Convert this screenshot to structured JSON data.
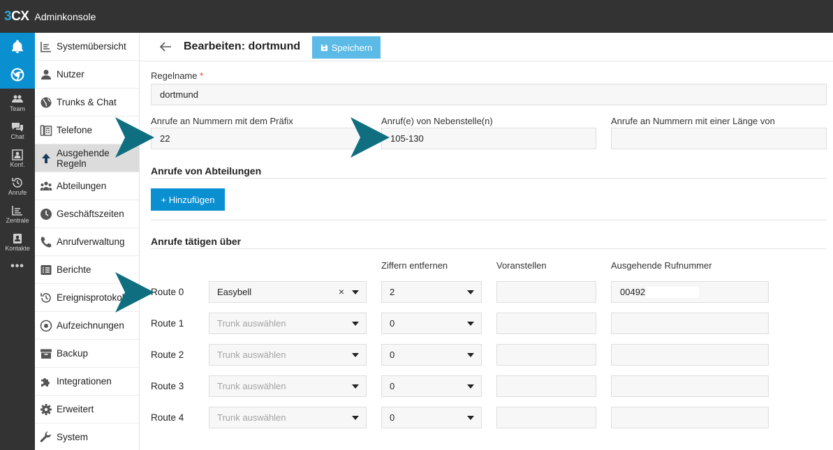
{
  "app": {
    "logo_num": "3",
    "logo_text": "CX",
    "title": "Adminkonsole"
  },
  "rail": [
    {
      "label": "Team",
      "icon": "team-icon"
    },
    {
      "label": "Chat",
      "icon": "chat-icon"
    },
    {
      "label": "Konf.",
      "icon": "conference-icon"
    },
    {
      "label": "Anrufe",
      "icon": "history-icon"
    },
    {
      "label": "Zentrale",
      "icon": "switchboard-icon"
    },
    {
      "label": "Kontakte",
      "icon": "contacts-icon"
    }
  ],
  "rail_more": "•••",
  "nav": [
    {
      "label": "Systemübersicht",
      "icon": "dashboard-icon"
    },
    {
      "label": "Nutzer",
      "icon": "user-icon"
    },
    {
      "label": "Trunks & Chat",
      "icon": "globe-icon"
    },
    {
      "label": "Telefone",
      "icon": "phone-device-icon"
    },
    {
      "label": "Ausgehende\nRegeln",
      "icon": "arrow-up-icon"
    },
    {
      "label": "Abteilungen",
      "icon": "group-icon"
    },
    {
      "label": "Geschäftszeiten",
      "icon": "clock-icon"
    },
    {
      "label": "Anrufverwaltung",
      "icon": "phone-icon"
    },
    {
      "label": "Berichte",
      "icon": "report-icon"
    },
    {
      "label": "Ereignisprotokoll",
      "icon": "history-icon"
    },
    {
      "label": "Aufzeichnungen",
      "icon": "record-icon"
    },
    {
      "label": "Backup",
      "icon": "archive-icon"
    },
    {
      "label": "Integrationen",
      "icon": "puzzle-icon"
    },
    {
      "label": "Erweitert",
      "icon": "gear-icon"
    },
    {
      "label": "System",
      "icon": "wrench-icon"
    }
  ],
  "header": {
    "title": "Bearbeiten: dortmund",
    "save_label": "Speichern"
  },
  "form": {
    "rule_name_label": "Regelname",
    "required_mark": "*",
    "rule_name_value": "dortmund",
    "prefix_label": "Anrufe an Nummern mit dem Präfix",
    "prefix_value": "22",
    "extensions_label": "Anruf(e) von Nebenstelle(n)",
    "extensions_value": "105-130",
    "length_label": "Anrufe an Nummern mit einer Länge von",
    "length_value": "",
    "departments_title": "Anrufe von Abteilungen",
    "add_label": "+ Hinzufügen",
    "routes_title": "Anrufe tätigen über"
  },
  "columns": {
    "strip": "Ziffern entfernen",
    "prepend": "Voranstellen",
    "outbound": "Ausgehende Rufnummer"
  },
  "routes": [
    {
      "label": "Route 0",
      "trunk": "Easybell",
      "placeholder": "",
      "strip": "2",
      "prepend": "",
      "outbound": "00492"
    },
    {
      "label": "Route 1",
      "trunk": "",
      "placeholder": "Trunk auswählen",
      "strip": "0",
      "prepend": "",
      "outbound": ""
    },
    {
      "label": "Route 2",
      "trunk": "",
      "placeholder": "Trunk auswählen",
      "strip": "0",
      "prepend": "",
      "outbound": ""
    },
    {
      "label": "Route 3",
      "trunk": "",
      "placeholder": "Trunk auswählen",
      "strip": "0",
      "prepend": "",
      "outbound": ""
    },
    {
      "label": "Route 4",
      "trunk": "",
      "placeholder": "Trunk auswählen",
      "strip": "0",
      "prepend": "",
      "outbound": ""
    }
  ],
  "clear_glyph": "×",
  "colors": {
    "topbar": "#333333",
    "accent": "#0a8fd0",
    "save": "#5bbbe6",
    "callout": "#0f6f80"
  }
}
